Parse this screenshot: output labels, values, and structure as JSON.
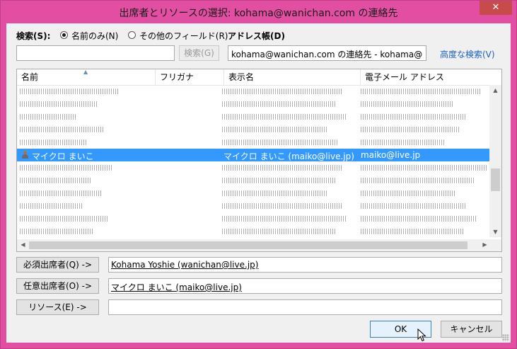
{
  "window": {
    "title": "出席者とリソースの選択: kohama@wanichan.com の連絡先",
    "close_glyph": "✕",
    "accent": "#e24fa2"
  },
  "search": {
    "label": "検索(S):",
    "radio_name_only": "名前のみ(N)",
    "radio_other_fields": "その他のフィールド(R)",
    "selected_radio": "name_only",
    "input_value": "",
    "search_button": "検索(G)"
  },
  "address_book": {
    "label": "アドレス帳(D)",
    "selected": "kohama@wanichan.com の連絡先 - kohama@",
    "advanced_search": "高度な検索(V)"
  },
  "list": {
    "columns": [
      "名前",
      "フリガナ",
      "表示名",
      "電子メール アドレス"
    ],
    "selected_row": {
      "name": "マイクロ まいこ",
      "furigana": "",
      "display_name": "マイクロ まいこ (maiko@live.jp)",
      "email": "maiko@live.jp"
    }
  },
  "recipients": {
    "required_button": "必須出席者(Q) ->",
    "required_value": "Kohama Yoshie (wanichan@live.jp)",
    "optional_button": "任意出席者(O) ->",
    "optional_value": "マイクロ まいこ (maiko@live.jp)",
    "resources_button": "リソース(E) ->",
    "resources_value": ""
  },
  "footer": {
    "ok": "OK",
    "cancel": "キャンセル"
  },
  "icons": {
    "close": "close-icon",
    "contact": "person-icon",
    "cursor": "mouse-pointer-icon",
    "sort": "sort-ascending-icon",
    "dropdown": "chevron-down-icon"
  }
}
